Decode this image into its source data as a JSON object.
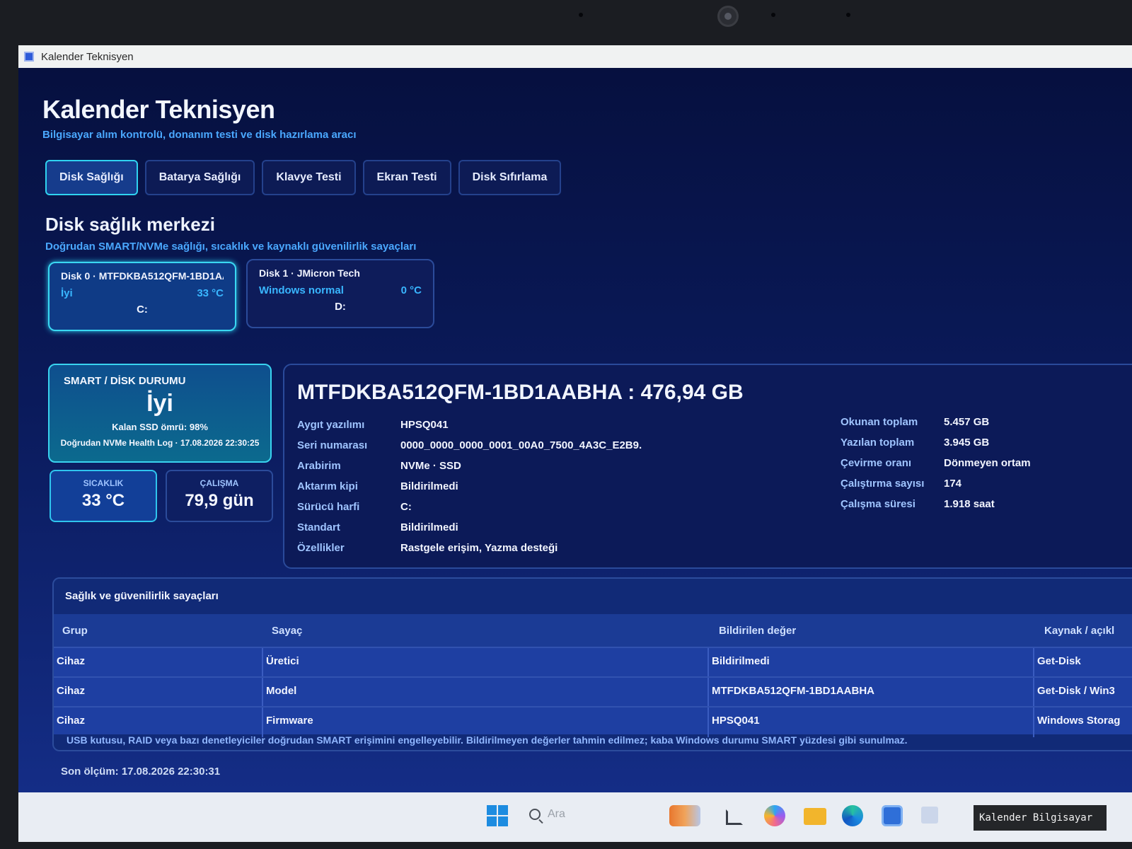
{
  "window": {
    "title": "Kalender Teknisyen"
  },
  "header": {
    "title": "Kalender Teknisyen",
    "subtitle": "Bilgisayar alım kontrolü, donanım testi ve disk hazırlama aracı"
  },
  "tabs": [
    {
      "label": "Disk Sağlığı",
      "active": true
    },
    {
      "label": "Batarya Sağlığı",
      "active": false
    },
    {
      "label": "Klavye Testi",
      "active": false
    },
    {
      "label": "Ekran Testi",
      "active": false
    },
    {
      "label": "Disk Sıfırlama",
      "active": false
    }
  ],
  "section": {
    "title": "Disk sağlık merkezi",
    "subtitle": "Doğrudan SMART/NVMe sağlığı, sıcaklık ve kaynaklı güvenilirlik sayaçları"
  },
  "disks": [
    {
      "name": "Disk 0 · MTFDKBA512QFM-1BD1AA...",
      "status": "İyi",
      "temp": "33 °C",
      "letter": "C:"
    },
    {
      "name": "Disk 1 · JMicron Tech",
      "status": "Windows normal",
      "temp": "0 °C",
      "letter": "D:"
    }
  ],
  "status": {
    "label": "SMART / DİSK DURUMU",
    "value": "İyi",
    "life": "Kalan SSD ömrü: 98%",
    "log": "Doğrudan NVMe Health Log · 17.08.2026 22:30:25"
  },
  "metrics": {
    "temp_label": "SICAKLIK",
    "temp_value": "33 °C",
    "uptime_label": "ÇALIŞMA",
    "uptime_value": "79,9 gün"
  },
  "detail": {
    "title": "MTFDKBA512QFM-1BD1AABHA : 476,94 GB",
    "left": [
      {
        "k": "Aygıt yazılımı",
        "v": "HPSQ041"
      },
      {
        "k": "Seri numarası",
        "v": "0000_0000_0000_0001_00A0_7500_4A3C_E2B9."
      },
      {
        "k": "Arabirim",
        "v": "NVMe · SSD"
      },
      {
        "k": "Aktarım kipi",
        "v": "Bildirilmedi"
      },
      {
        "k": "Sürücü harfi",
        "v": "C:"
      },
      {
        "k": "Standart",
        "v": "Bildirilmedi"
      },
      {
        "k": "Özellikler",
        "v": "Rastgele erişim, Yazma desteği"
      }
    ],
    "right": [
      {
        "k": "Okunan toplam",
        "v": "5.457 GB"
      },
      {
        "k": "Yazılan toplam",
        "v": "3.945 GB"
      },
      {
        "k": "Çevirme oranı",
        "v": "Dönmeyen ortam"
      },
      {
        "k": "Çalıştırma sayısı",
        "v": "174"
      },
      {
        "k": "Çalışma süresi",
        "v": "1.918 saat"
      }
    ]
  },
  "counters": {
    "title": "Sağlık ve güvenilirlik sayaçları",
    "columns": [
      "Grup",
      "Sayaç",
      "Bildirilen değer",
      "Kaynak / açıkl"
    ],
    "rows": [
      [
        "Cihaz",
        "Üretici",
        "Bildirilmedi",
        "Get-Disk"
      ],
      [
        "Cihaz",
        "Model",
        "MTFDKBA512QFM-1BD1AABHA",
        "Get-Disk / Win3"
      ],
      [
        "Cihaz",
        "Firmware",
        "HPSQ041",
        "Windows Storag"
      ]
    ],
    "note": "USB kutusu, RAID veya bazı denetleyiciler doğrudan SMART erişimini engelleyebilir. Bildirilmeyen değerler tahmin edilmez; kaba Windows durumu SMART yüzdesi gibi sunulmaz."
  },
  "footer": {
    "last_measure": "Son ölçüm: 17.08.2026 22:30:31"
  },
  "taskbar": {
    "search_placeholder": "Ara",
    "icons": [
      "windows-start-icon",
      "search-icon",
      "widgets-icon",
      "task-view-icon",
      "copilot-icon",
      "file-explorer-icon",
      "edge-icon",
      "store-icon",
      "app-icon"
    ]
  },
  "watermark": "Kalender Bilgisayar",
  "colors": {
    "accent_cyan": "#3ad8f2",
    "accent_blue": "#4aa8ff",
    "background": "#0a1a5a"
  }
}
